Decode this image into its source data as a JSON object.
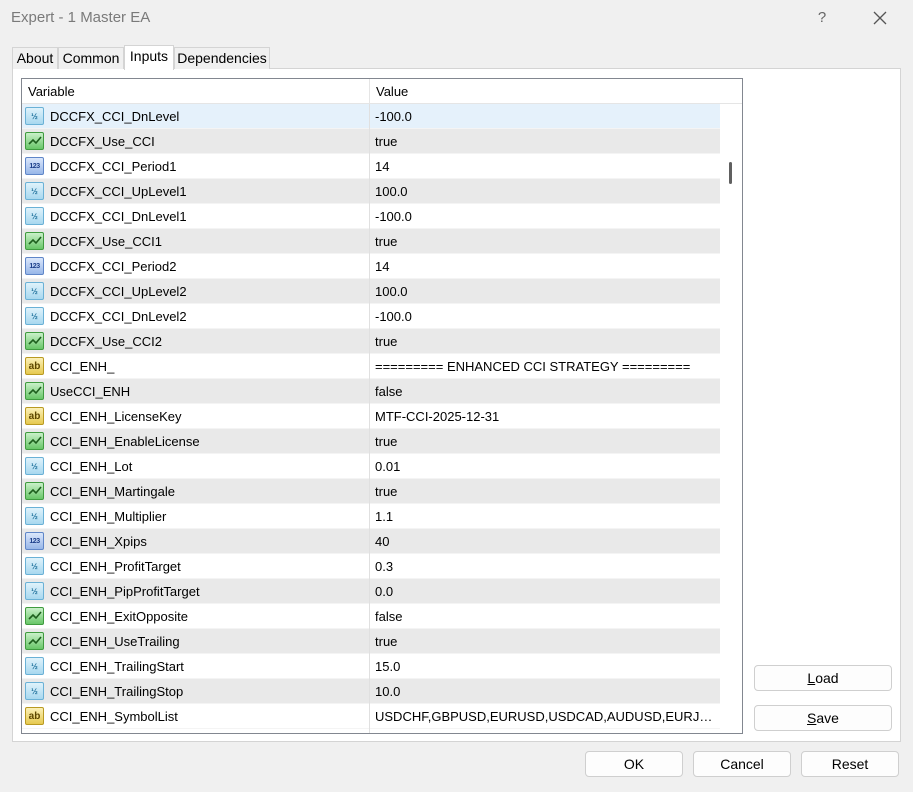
{
  "window": {
    "title": "Expert - 1 Master EA",
    "help_label": "?"
  },
  "tabs": [
    {
      "label": "About"
    },
    {
      "label": "Common"
    },
    {
      "label": "Inputs"
    },
    {
      "label": "Dependencies"
    }
  ],
  "grid": {
    "col_variable": "Variable",
    "col_value": "Value",
    "rows": [
      {
        "type": "double",
        "icon": "half-icon",
        "name": "DCCFX_CCI_DnLevel",
        "value": "-100.0"
      },
      {
        "type": "bool",
        "icon": "check-icon",
        "name": "DCCFX_Use_CCI",
        "value": "true"
      },
      {
        "type": "int",
        "icon": "123-icon",
        "name": "DCCFX_CCI_Period1",
        "value": "14"
      },
      {
        "type": "double",
        "icon": "half-icon",
        "name": "DCCFX_CCI_UpLevel1",
        "value": "100.0"
      },
      {
        "type": "double",
        "icon": "half-icon",
        "name": "DCCFX_CCI_DnLevel1",
        "value": "-100.0"
      },
      {
        "type": "bool",
        "icon": "check-icon",
        "name": "DCCFX_Use_CCI1",
        "value": "true"
      },
      {
        "type": "int",
        "icon": "123-icon",
        "name": "DCCFX_CCI_Period2",
        "value": "14"
      },
      {
        "type": "double",
        "icon": "half-icon",
        "name": "DCCFX_CCI_UpLevel2",
        "value": "100.0"
      },
      {
        "type": "double",
        "icon": "half-icon",
        "name": "DCCFX_CCI_DnLevel2",
        "value": "-100.0"
      },
      {
        "type": "bool",
        "icon": "check-icon",
        "name": "DCCFX_Use_CCI2",
        "value": "true"
      },
      {
        "type": "string",
        "icon": "ab-icon",
        "name": "CCI_ENH_",
        "value": "========= ENHANCED CCI STRATEGY ========="
      },
      {
        "type": "bool",
        "icon": "check-icon",
        "name": "UseCCI_ENH",
        "value": "false"
      },
      {
        "type": "string",
        "icon": "ab-icon",
        "name": "CCI_ENH_LicenseKey",
        "value": "MTF-CCI-2025-12-31"
      },
      {
        "type": "bool",
        "icon": "check-icon",
        "name": "CCI_ENH_EnableLicense",
        "value": "true"
      },
      {
        "type": "double",
        "icon": "half-icon",
        "name": "CCI_ENH_Lot",
        "value": "0.01"
      },
      {
        "type": "bool",
        "icon": "check-icon",
        "name": "CCI_ENH_Martingale",
        "value": "true"
      },
      {
        "type": "double",
        "icon": "half-icon",
        "name": "CCI_ENH_Multiplier",
        "value": "1.1"
      },
      {
        "type": "int",
        "icon": "123-icon",
        "name": "CCI_ENH_Xpips",
        "value": "40"
      },
      {
        "type": "double",
        "icon": "half-icon",
        "name": "CCI_ENH_ProfitTarget",
        "value": "0.3"
      },
      {
        "type": "double",
        "icon": "half-icon",
        "name": "CCI_ENH_PipProfitTarget",
        "value": "0.0"
      },
      {
        "type": "bool",
        "icon": "check-icon",
        "name": "CCI_ENH_ExitOpposite",
        "value": "false"
      },
      {
        "type": "bool",
        "icon": "check-icon",
        "name": "CCI_ENH_UseTrailing",
        "value": "true"
      },
      {
        "type": "double",
        "icon": "half-icon",
        "name": "CCI_ENH_TrailingStart",
        "value": "15.0"
      },
      {
        "type": "double",
        "icon": "half-icon",
        "name": "CCI_ENH_TrailingStop",
        "value": "10.0"
      },
      {
        "type": "string",
        "icon": "ab-icon",
        "name": "CCI_ENH_SymbolList",
        "value": "USDCHF,GBPUSD,EURUSD,USDCAD,AUDUSD,EURJPY,GBPJPY"
      }
    ]
  },
  "buttons": {
    "load": "Load",
    "save": "Save",
    "ok": "OK",
    "cancel": "Cancel",
    "reset": "Reset"
  }
}
